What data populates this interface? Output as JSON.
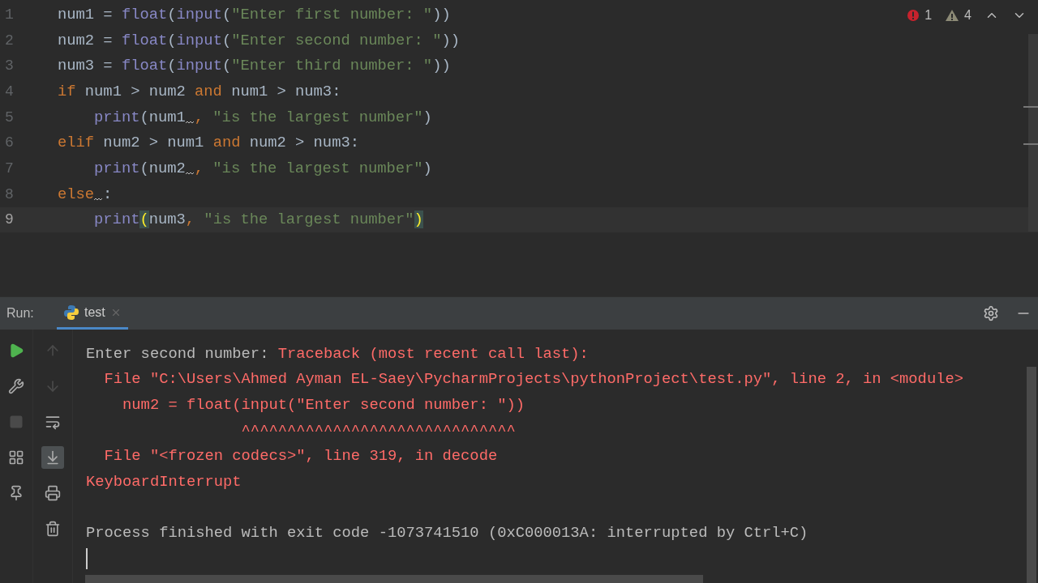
{
  "editor": {
    "lines": [
      {
        "number": "1",
        "current": false,
        "tokens": [
          {
            "kind": "plain",
            "text": "num1 = "
          },
          {
            "kind": "builtin",
            "text": "float"
          },
          {
            "kind": "plain",
            "text": "("
          },
          {
            "kind": "builtin",
            "text": "input"
          },
          {
            "kind": "plain",
            "text": "("
          },
          {
            "kind": "string",
            "text": "\"Enter first number: \""
          },
          {
            "kind": "plain",
            "text": "))"
          }
        ]
      },
      {
        "number": "2",
        "current": false,
        "tokens": [
          {
            "kind": "plain",
            "text": "num2 = "
          },
          {
            "kind": "builtin",
            "text": "float"
          },
          {
            "kind": "plain",
            "text": "("
          },
          {
            "kind": "builtin",
            "text": "input"
          },
          {
            "kind": "plain",
            "text": "("
          },
          {
            "kind": "string",
            "text": "\"Enter second number: \""
          },
          {
            "kind": "plain",
            "text": "))"
          }
        ]
      },
      {
        "number": "3",
        "current": false,
        "tokens": [
          {
            "kind": "plain",
            "text": "num3 = "
          },
          {
            "kind": "builtin",
            "text": "float"
          },
          {
            "kind": "plain",
            "text": "("
          },
          {
            "kind": "builtin",
            "text": "input"
          },
          {
            "kind": "plain",
            "text": "("
          },
          {
            "kind": "string",
            "text": "\"Enter third number: \""
          },
          {
            "kind": "plain",
            "text": "))"
          }
        ]
      },
      {
        "number": "4",
        "current": false,
        "tokens": [
          {
            "kind": "keyword",
            "text": "if"
          },
          {
            "kind": "plain",
            "text": " num1 > num2 "
          },
          {
            "kind": "keyword",
            "text": "and"
          },
          {
            "kind": "plain",
            "text": " num1 > num3:"
          }
        ]
      },
      {
        "number": "5",
        "current": false,
        "tokens": [
          {
            "kind": "builtin",
            "text": "    print"
          },
          {
            "kind": "plain",
            "text": "(num1",
            "warning": true
          },
          {
            "kind": "keyword",
            "text": ", "
          },
          {
            "kind": "string",
            "text": "\"is the largest number\""
          },
          {
            "kind": "plain",
            "text": ")"
          }
        ]
      },
      {
        "number": "6",
        "current": false,
        "tokens": [
          {
            "kind": "keyword",
            "text": "elif"
          },
          {
            "kind": "plain",
            "text": " num2 > num1 "
          },
          {
            "kind": "keyword",
            "text": "and"
          },
          {
            "kind": "plain",
            "text": " num2 > num3:"
          }
        ]
      },
      {
        "number": "7",
        "current": false,
        "tokens": [
          {
            "kind": "builtin",
            "text": "    print"
          },
          {
            "kind": "plain",
            "text": "(num2",
            "warning": true
          },
          {
            "kind": "keyword",
            "text": ", "
          },
          {
            "kind": "string",
            "text": "\"is the largest number\""
          },
          {
            "kind": "plain",
            "text": ")"
          }
        ]
      },
      {
        "number": "8",
        "current": false,
        "tokens": [
          {
            "kind": "keyword",
            "text": "else",
            "warning": true
          },
          {
            "kind": "plain",
            "text": ":"
          }
        ]
      },
      {
        "number": "9",
        "current": true,
        "tokens": [
          {
            "kind": "builtin",
            "text": "    print"
          },
          {
            "kind": "brace",
            "text": "("
          },
          {
            "kind": "plain",
            "text": "num3"
          },
          {
            "kind": "keyword",
            "text": ", "
          },
          {
            "kind": "string",
            "text": "\"is the largest number\""
          },
          {
            "kind": "brace",
            "text": ")"
          }
        ]
      }
    ],
    "inspections": {
      "errors": "1",
      "warnings": "4"
    }
  },
  "run_panel": {
    "label": "Run:",
    "tabs": [
      {
        "label": "test",
        "selected": true
      }
    ],
    "console": [
      {
        "segments": [
          {
            "kind": "output",
            "text": "Enter second number: "
          },
          {
            "kind": "error",
            "text": "Traceback (most recent call last):"
          }
        ]
      },
      {
        "segments": [
          {
            "kind": "error",
            "text": "  File \"C:\\Users\\Ahmed Ayman EL-Saey\\PycharmProjects\\pythonProject\\test.py\", line 2, in <module>"
          }
        ]
      },
      {
        "segments": [
          {
            "kind": "error",
            "text": "    num2 = float(input(\"Enter second number: \"))"
          }
        ]
      },
      {
        "segments": [
          {
            "kind": "error",
            "text": "                 ^^^^^^^^^^^^^^^^^^^^^^^^^^^^^^"
          }
        ]
      },
      {
        "segments": [
          {
            "kind": "error",
            "text": "  File \"<frozen codecs>\", line 319, in decode"
          }
        ]
      },
      {
        "segments": [
          {
            "kind": "error",
            "text": "KeyboardInterrupt"
          }
        ]
      },
      {
        "blank_line_before": true,
        "segments": [
          {
            "kind": "output",
            "text": "Process finished with exit code -1073741510 (0xC000013A: interrupted by Ctrl+C)"
          }
        ]
      }
    ]
  }
}
